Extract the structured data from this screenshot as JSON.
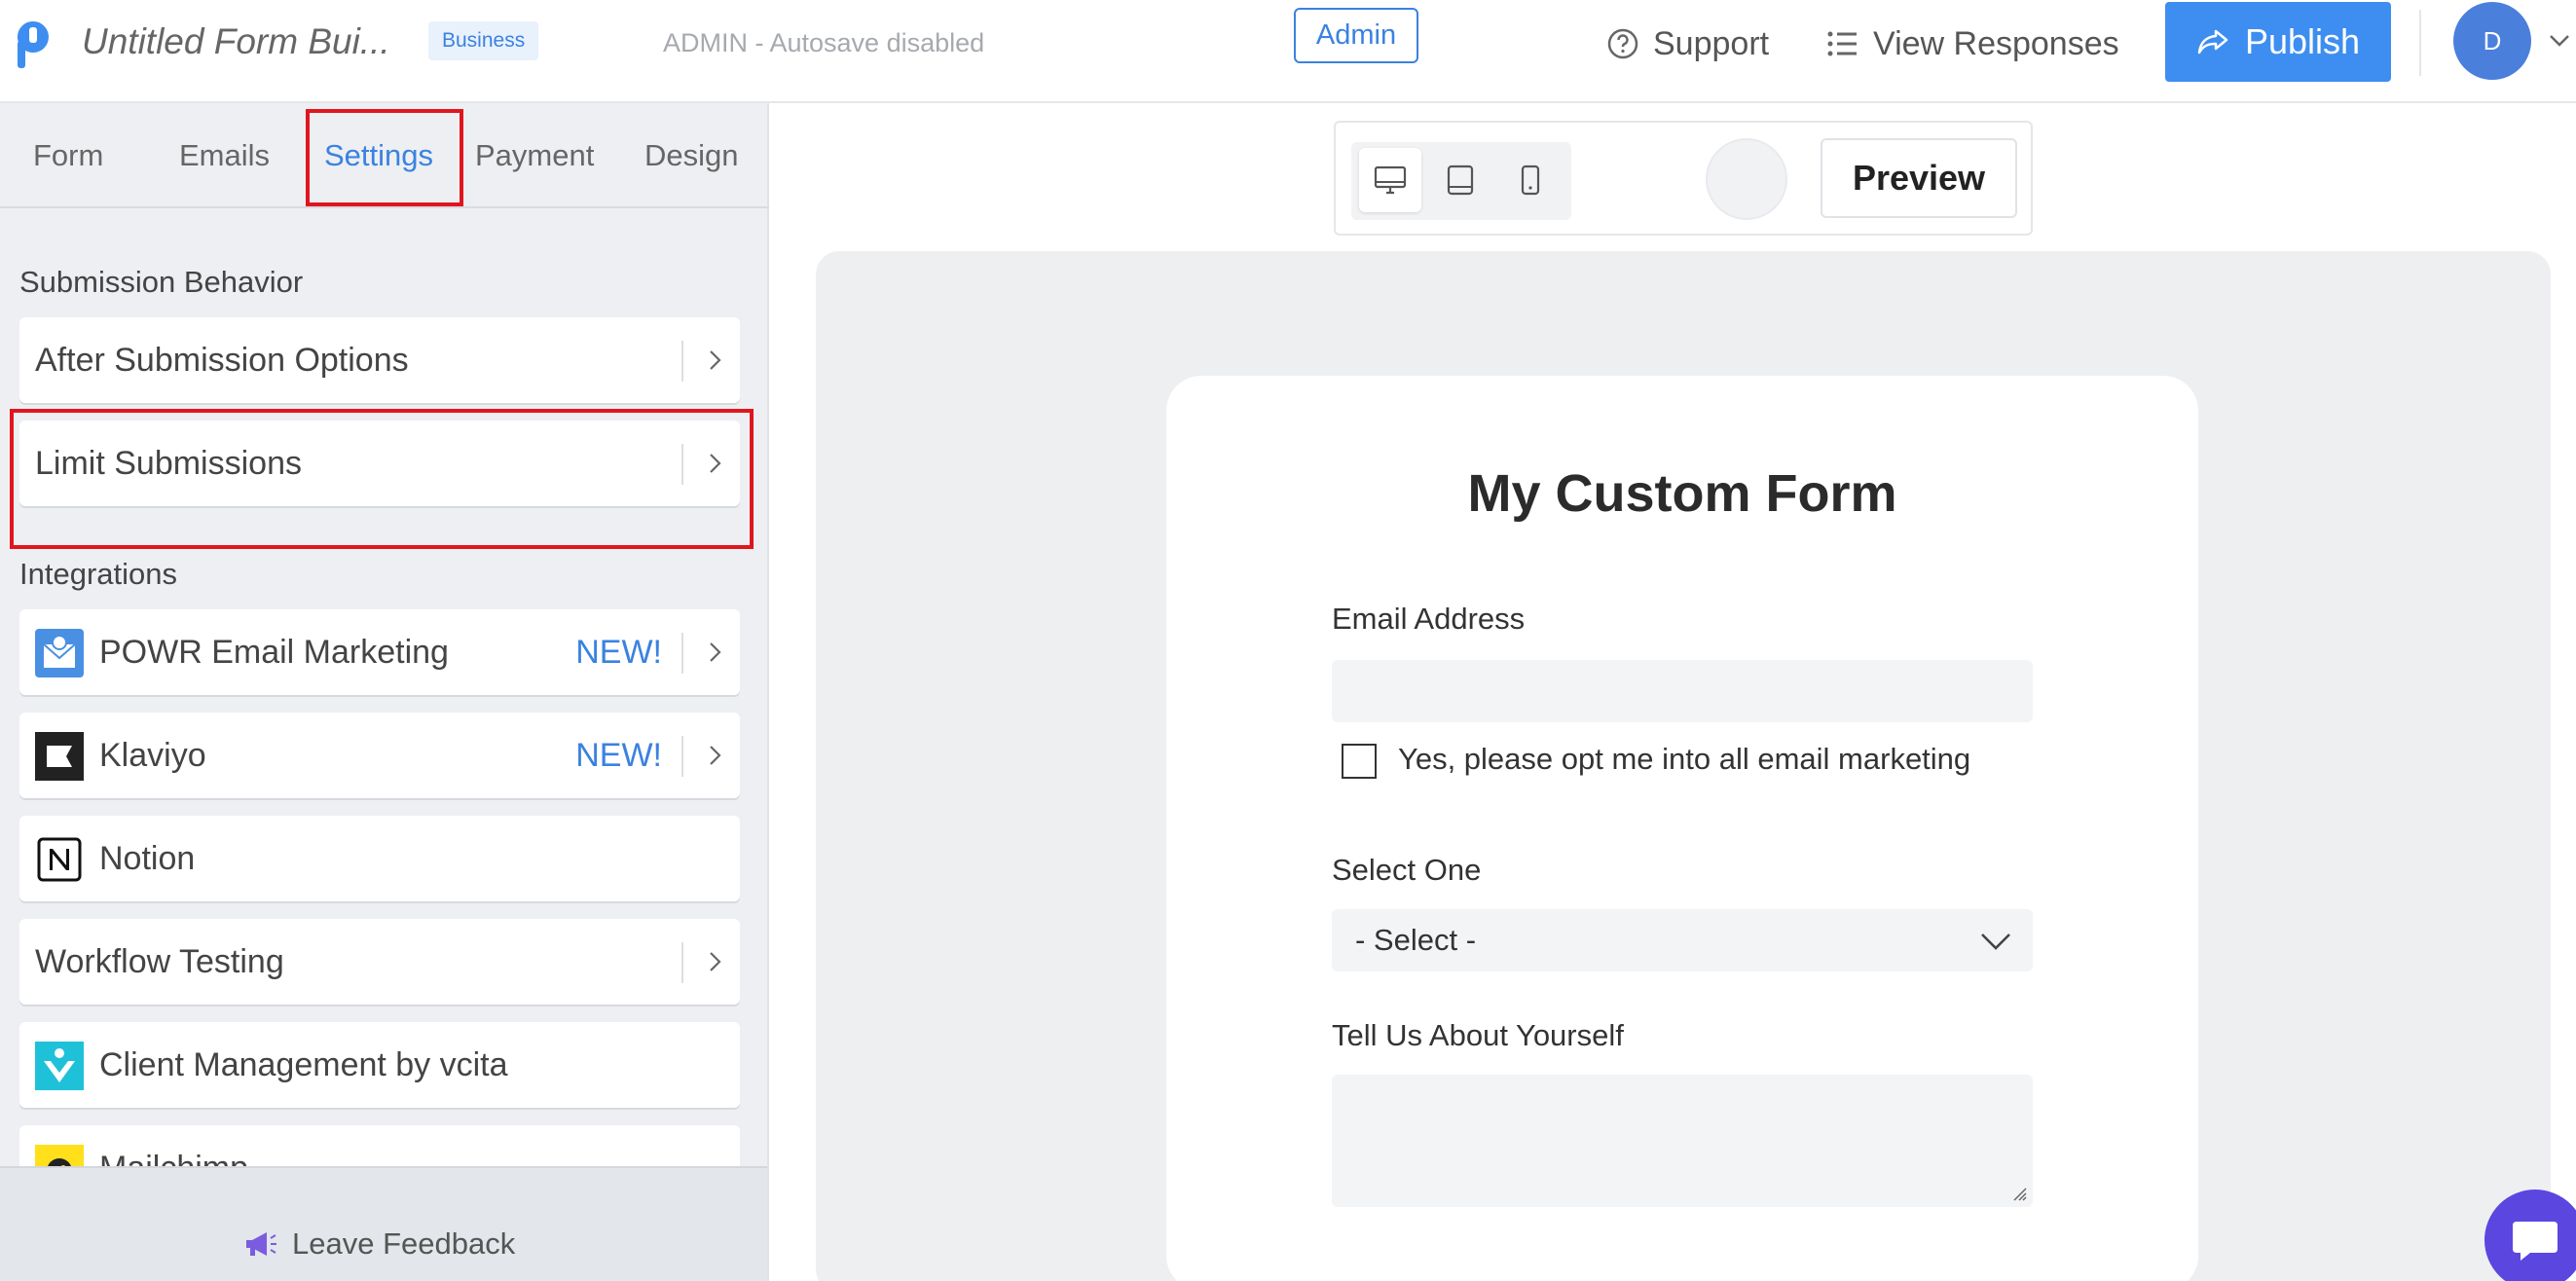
{
  "header": {
    "form_title": "Untitled Form Bui...",
    "plan_badge": "Business",
    "autosave_status": "ADMIN - Autosave disabled",
    "admin_label": "Admin",
    "support_label": "Support",
    "view_responses_label": "View Responses",
    "publish_label": "Publish",
    "avatar_initial": "D"
  },
  "tabs": [
    {
      "label": "Form",
      "active": false
    },
    {
      "label": "Emails",
      "active": false
    },
    {
      "label": "Settings",
      "active": true
    },
    {
      "label": "Payment",
      "active": false
    },
    {
      "label": "Design",
      "active": false
    }
  ],
  "settings": {
    "submission_behavior": {
      "heading": "Submission Behavior",
      "items": [
        {
          "label": "After Submission Options"
        },
        {
          "label": "Limit Submissions"
        }
      ]
    },
    "integrations": {
      "heading": "Integrations",
      "items": [
        {
          "label": "POWR Email Marketing",
          "badge": "NEW!",
          "icon": "email-marketing-icon"
        },
        {
          "label": "Klaviyo",
          "badge": "NEW!",
          "icon": "klaviyo-icon"
        },
        {
          "label": "Notion",
          "icon": "notion-icon"
        },
        {
          "label": "Workflow Testing"
        },
        {
          "label": "Client Management by vcita",
          "icon": "vcita-icon"
        },
        {
          "label": "Mailchimp",
          "icon": "mailchimp-icon"
        }
      ]
    }
  },
  "feedback_label": "Leave Feedback",
  "preview": {
    "preview_label": "Preview"
  },
  "form": {
    "title": "My Custom Form",
    "fields": {
      "email_label": "Email Address",
      "opt_in_label": "Yes, please opt me into all email marketing",
      "select_label": "Select One",
      "select_value": "- Select -",
      "about_label": "Tell Us About Yourself"
    }
  },
  "colors": {
    "accent": "#3b82e0",
    "publish": "#3d8ef0",
    "highlight": "#e0161e",
    "chat": "#5b46e0"
  }
}
